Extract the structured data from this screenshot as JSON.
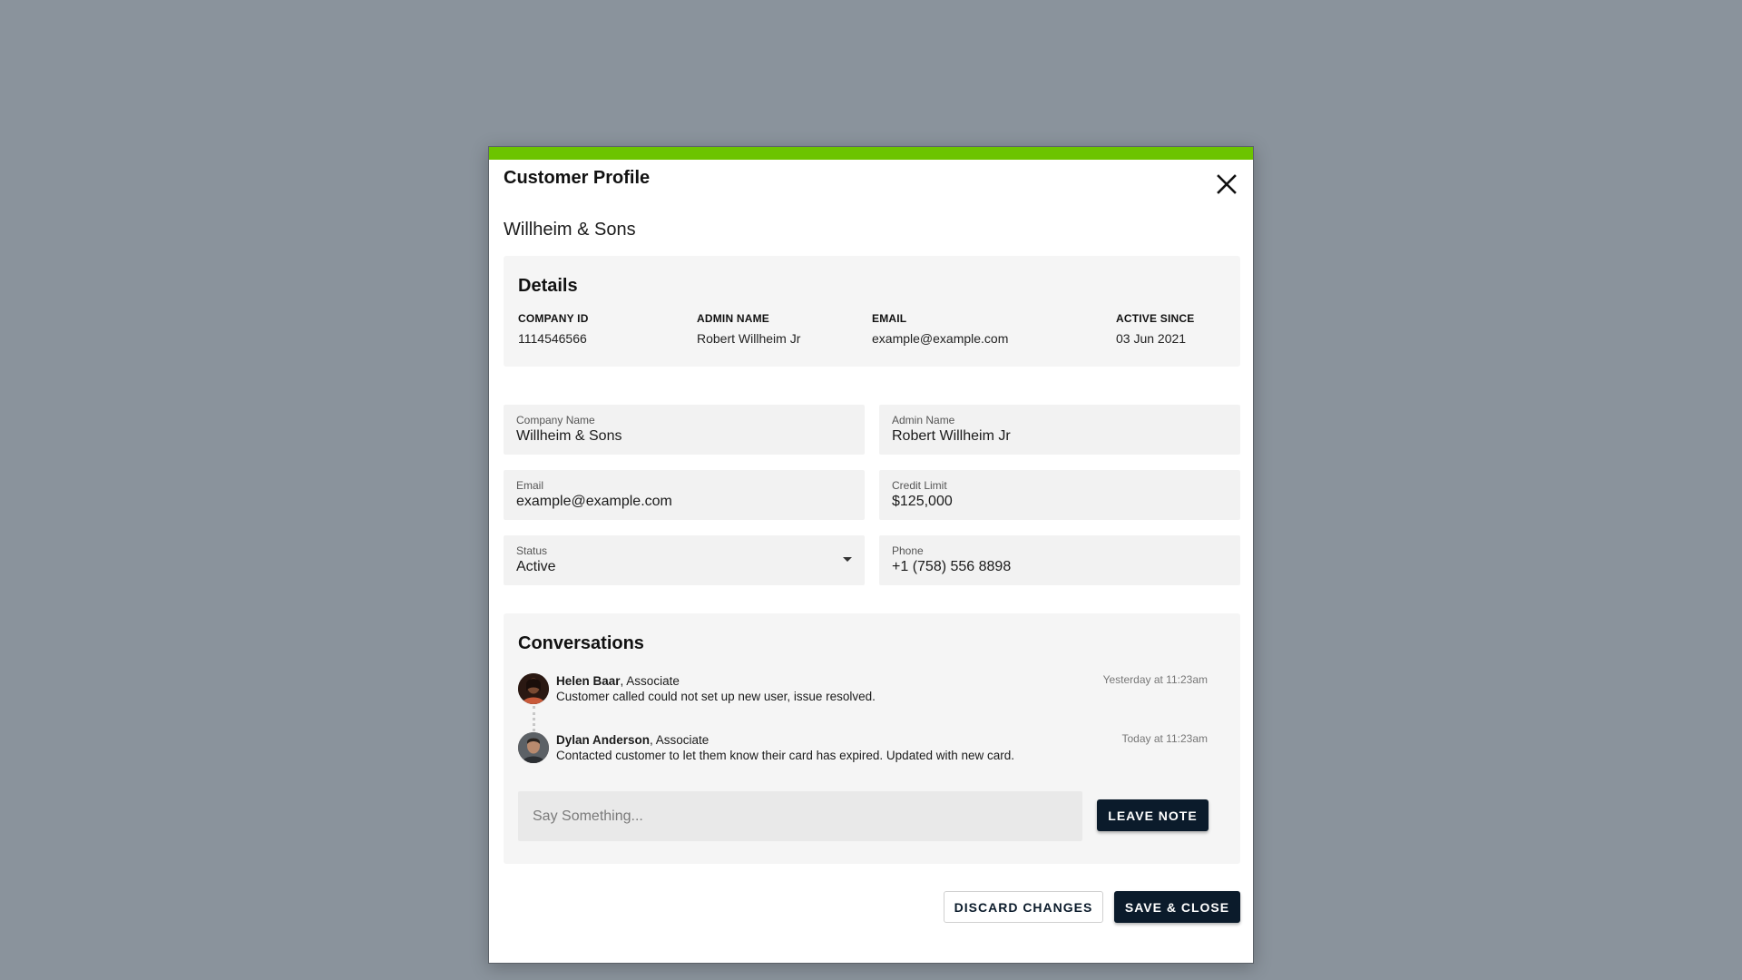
{
  "dialog": {
    "title": "Customer Profile",
    "company_heading": "Willheim & Sons",
    "accent_color": "#6cc400"
  },
  "details": {
    "title": "Details",
    "items": [
      {
        "label": "COMPANY ID",
        "value": "1114546566"
      },
      {
        "label": "ADMIN NAME",
        "value": "Robert Willheim Jr"
      },
      {
        "label": "EMAIL",
        "value": "example@example.com"
      },
      {
        "label": "ACTIVE SINCE",
        "value": "03 Jun 2021"
      }
    ]
  },
  "form": {
    "company_name": {
      "label": "Company Name",
      "value": "Willheim & Sons"
    },
    "admin_name": {
      "label": "Admin Name",
      "value": "Robert Willheim Jr"
    },
    "email": {
      "label": "Email",
      "value": "example@example.com"
    },
    "credit_limit": {
      "label": "Credit Limit",
      "value": "$125,000"
    },
    "status": {
      "label": "Status",
      "value": "Active"
    },
    "phone": {
      "label": "Phone",
      "value": "+1 (758) 556 8898"
    }
  },
  "conversations": {
    "title": "Conversations",
    "items": [
      {
        "name": "Helen Baar",
        "role": ", Associate",
        "message": "Customer called could not set up new user, issue resolved.",
        "time": "Yesterday at 11:23am"
      },
      {
        "name": "Dylan Anderson",
        "role": ", Associate",
        "message": "Contacted customer to let them know their card has expired. Updated with new card.",
        "time": "Today at 11:23am"
      }
    ],
    "input_placeholder": "Say Something...",
    "leave_note_label": "LEAVE NOTE"
  },
  "footer": {
    "discard_label": "DISCARD CHANGES",
    "save_label": "SAVE & CLOSE"
  }
}
